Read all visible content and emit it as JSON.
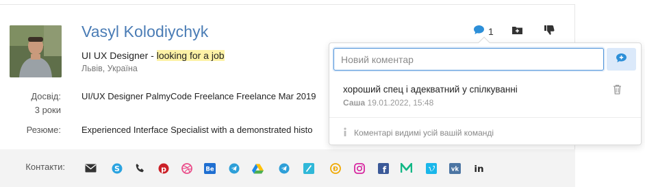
{
  "profile": {
    "name": "Vasyl Kolodiychyk",
    "headline_prefix": "UI UX Designer - ",
    "headline_highlight": "looking for a job",
    "location": "Львів, Україна"
  },
  "details": {
    "experience_label": "Досвід:",
    "experience_value": "3 роки",
    "experience_text": "UI/UX Designer PalmyCode Freelance Freelance Mar 2019",
    "resume_label": "Резюме:",
    "resume_text": "Experienced Interface Specialist with a demonstrated histo"
  },
  "actions": {
    "comment_count": "1",
    "icons": [
      "comment-icon",
      "add-to-folder-icon",
      "thumbs-down-icon"
    ]
  },
  "comments_popup": {
    "input_placeholder": "Новий коментар",
    "comment_text": "хороший спец і адекватний у спілкуванні",
    "comment_author": "Саша",
    "comment_date": "19.01.2022, 15:48",
    "visibility_note": "Коментарі видимі усій вашій команді"
  },
  "contacts": {
    "label": "Контакти:",
    "icons": [
      "email-icon",
      "skype-icon",
      "phone-icon",
      "pinterest-icon",
      "dribbble-icon",
      "behance-icon",
      "telegram-icon",
      "google-drive-icon",
      "telegram-icon",
      "link-icon",
      "djinni-icon",
      "instagram-icon",
      "facebook-icon",
      "medium-icon",
      "vimeo-icon",
      "vk-icon",
      "linkedin-icon"
    ]
  },
  "colors": {
    "name_link": "#4a7cb5",
    "accent_blue": "#2d8fd8",
    "highlight": "#fdf2a6",
    "contacts_bg": "#f3f3f3"
  }
}
